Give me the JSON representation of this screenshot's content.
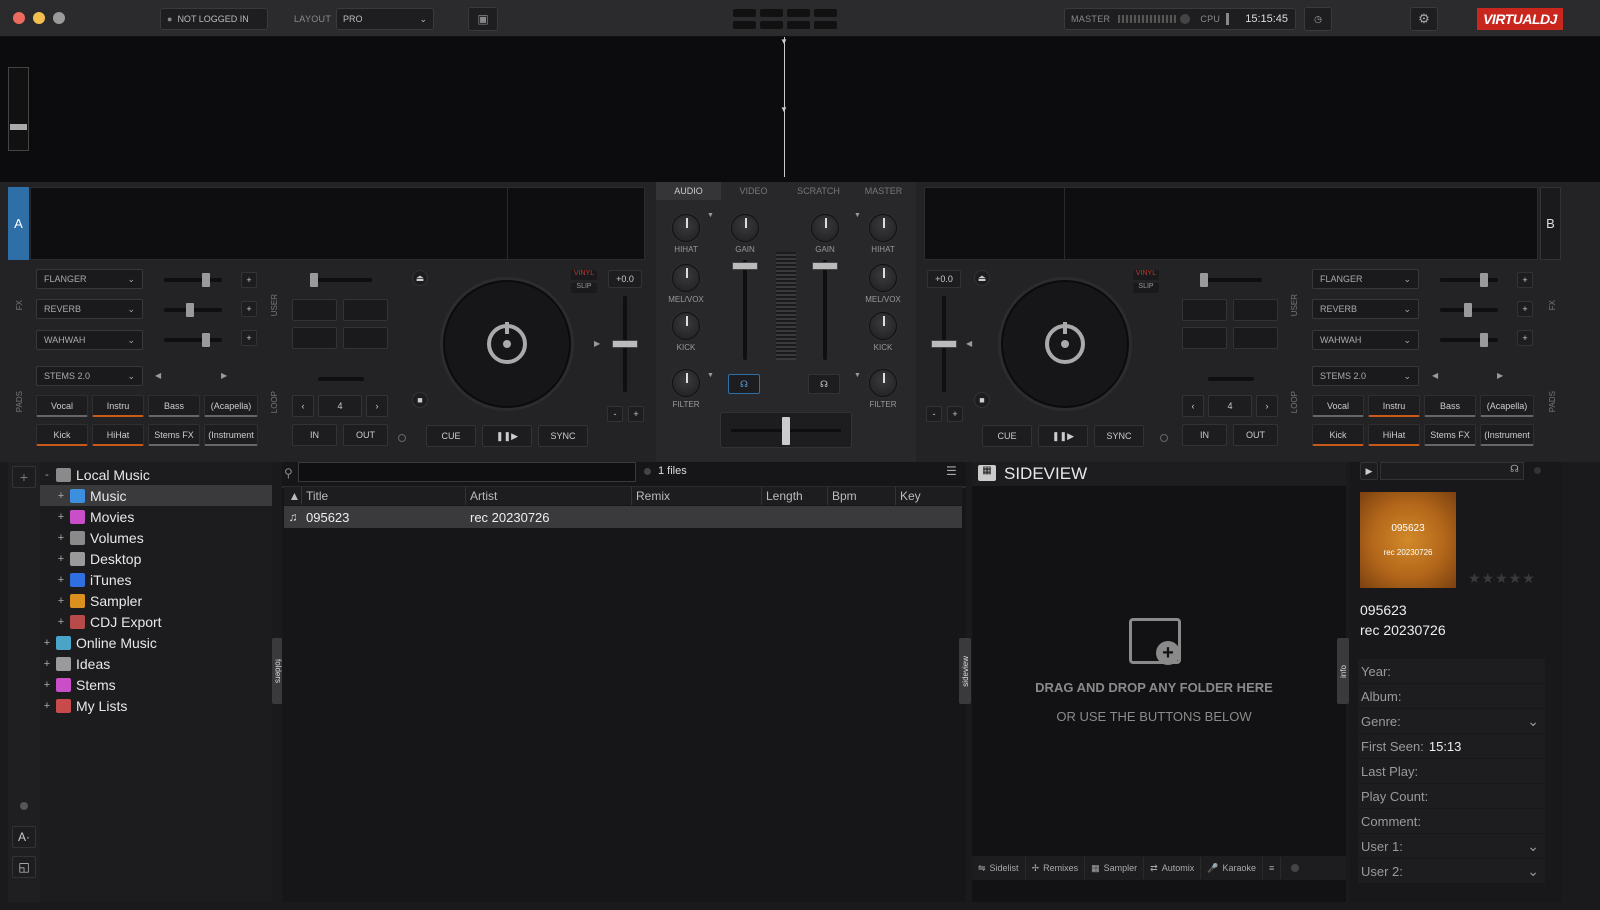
{
  "window": {
    "controls": [
      "close",
      "minimize",
      "maximize"
    ]
  },
  "topbar": {
    "login": "NOT LOGGED IN",
    "layout_label": "LAYOUT",
    "layout_value": "PRO",
    "master_label": "MASTER",
    "cpu_label": "CPU",
    "clock": "15:15:45",
    "logo": "VIRTUALDJ"
  },
  "mixer": {
    "tabs": [
      "AUDIO",
      "VIDEO",
      "SCRATCH",
      "MASTER"
    ],
    "knob_labels": {
      "hihat": "HIHAT",
      "gain": "GAIN",
      "melvox": "MEL/VOX",
      "kick": "KICK",
      "filter": "FILTER"
    }
  },
  "deck_a": {
    "letter": "A",
    "fx": [
      "FLANGER",
      "REVERB",
      "WAHWAH"
    ],
    "fx_side": "FX",
    "user_side": "USER",
    "pads_side": "PADS",
    "loop_side": "LOOP",
    "stems_mode": "STEMS 2.0",
    "pads_row1": [
      "Vocal",
      "Instru",
      "Bass",
      "(Acapella)"
    ],
    "pads_row2": [
      "Kick",
      "HiHat",
      "Stems FX",
      "(Instrument"
    ],
    "loop_size": "4",
    "loop_in": "IN",
    "loop_out": "OUT",
    "vinyl": "VINYL",
    "slip": "SLIP",
    "pitch": "+0.0",
    "cue": "CUE",
    "sync": "SYNC",
    "minus": "-",
    "plus": "+"
  },
  "deck_b": {
    "letter": "B",
    "fx": [
      "FLANGER",
      "REVERB",
      "WAHWAH"
    ],
    "fx_side": "FX",
    "user_side": "USER",
    "pads_side": "PADS",
    "loop_side": "LOOP",
    "stems_mode": "STEMS 2.0",
    "pads_row1": [
      "Vocal",
      "Instru",
      "Bass",
      "(Acapella)"
    ],
    "pads_row2": [
      "Kick",
      "HiHat",
      "Stems FX",
      "(Instrument"
    ],
    "loop_size": "4",
    "loop_in": "IN",
    "loop_out": "OUT",
    "vinyl": "VINYL",
    "slip": "SLIP",
    "pitch": "+0.0",
    "cue": "CUE",
    "sync": "SYNC",
    "minus": "-",
    "plus": "+"
  },
  "tree": {
    "items": [
      {
        "label": "Local Music",
        "icon": "local-music-icon",
        "color": "#8a8a8a",
        "expander": "-"
      },
      {
        "label": "Music",
        "icon": "music-folder-icon",
        "color": "#3d8fe0",
        "expander": "+"
      },
      {
        "label": "Movies",
        "icon": "movies-folder-icon",
        "color": "#c94fc9",
        "expander": "+"
      },
      {
        "label": "Volumes",
        "icon": "volumes-icon",
        "color": "#8a8a8a",
        "expander": "+"
      },
      {
        "label": "Desktop",
        "icon": "desktop-icon",
        "color": "#9a9a9a",
        "expander": "+"
      },
      {
        "label": "iTunes",
        "icon": "itunes-icon",
        "color": "#2f6fe0",
        "expander": "+"
      },
      {
        "label": "Sampler",
        "icon": "sampler-icon",
        "color": "#d9901f",
        "expander": "+"
      },
      {
        "label": "CDJ Export",
        "icon": "cdj-export-icon",
        "color": "#b84a4a",
        "expander": "+"
      },
      {
        "label": "Online Music",
        "icon": "online-music-icon",
        "color": "#4aa3c9",
        "expander": "+"
      },
      {
        "label": "Ideas",
        "icon": "ideas-icon",
        "color": "#9a9a9a",
        "expander": "+"
      },
      {
        "label": "Stems",
        "icon": "stems-icon",
        "color": "#c94fc9",
        "expander": "+"
      },
      {
        "label": "My Lists",
        "icon": "my-lists-icon",
        "color": "#c94a4a",
        "expander": "+"
      }
    ],
    "folders_tab": "folders"
  },
  "filelist": {
    "search_placeholder": "",
    "count": "1 files",
    "columns": [
      "Title",
      "Artist",
      "Remix",
      "Length",
      "Bpm",
      "Key"
    ],
    "rows": [
      {
        "title": "095623",
        "artist": "rec 20230726",
        "remix": "",
        "length": "",
        "bpm": "",
        "key": ""
      }
    ]
  },
  "sideview": {
    "title": "SIDEVIEW",
    "tab": "sideview",
    "drop_line1": "DRAG AND DROP ANY FOLDER HERE",
    "drop_line2": "OR USE THE BUTTONS BELOW",
    "buttons": [
      "Sidelist",
      "Remixes",
      "Sampler",
      "Automix",
      "Karaoke"
    ]
  },
  "info": {
    "tab": "info",
    "art_title": "095623",
    "art_artist": "rec 20230726",
    "title": "095623",
    "artist": "rec 20230726",
    "rating": 0,
    "fields": [
      {
        "label": "Year:",
        "value": ""
      },
      {
        "label": "Album:",
        "value": ""
      },
      {
        "label": "Genre:",
        "value": "",
        "dropdown": true
      },
      {
        "label": "First Seen:",
        "value": "15:13"
      },
      {
        "label": "Last Play:",
        "value": ""
      },
      {
        "label": "Play Count:",
        "value": ""
      },
      {
        "label": "Comment:",
        "value": ""
      },
      {
        "label": "User 1:",
        "value": "",
        "dropdown": true
      },
      {
        "label": "User 2:",
        "value": "",
        "dropdown": true
      }
    ]
  }
}
